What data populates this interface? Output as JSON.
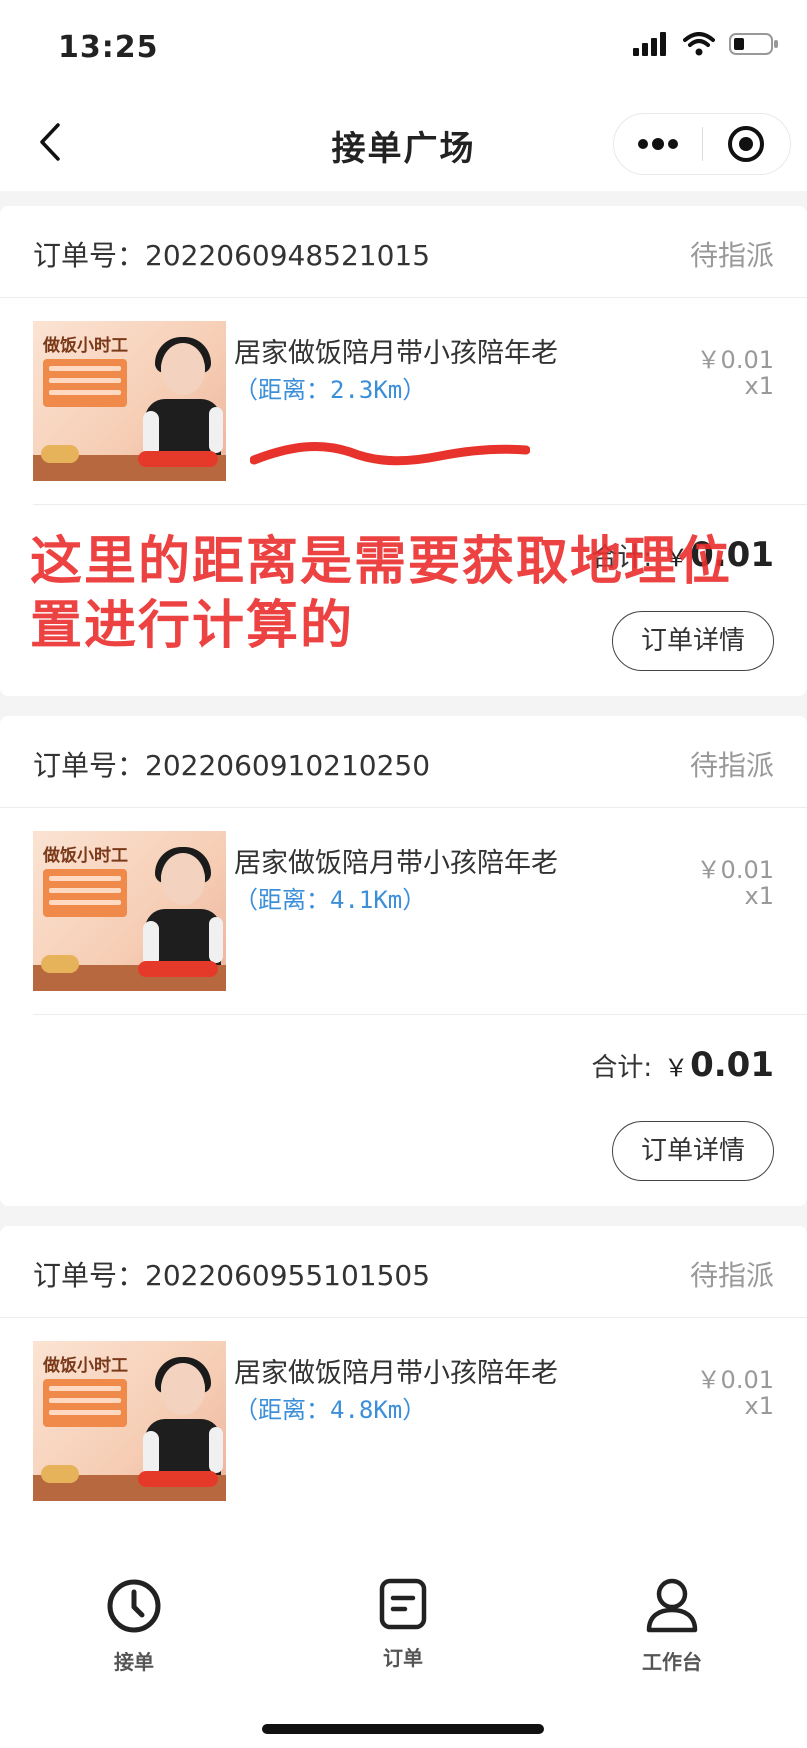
{
  "status_bar": {
    "time": "13:25"
  },
  "nav": {
    "title": "接单广场",
    "icons": {
      "back": "chevron-left-icon",
      "more": "more-dots-icon",
      "close": "target-circle-icon"
    }
  },
  "orders": [
    {
      "order_label": "订单号：",
      "order_no": "2022060948521015",
      "status": "待指派",
      "item_title": "居家做饭陪月带小孩陪年老",
      "distance": "（距离：2.3Km）",
      "price": "￥0.01",
      "qty": "x1",
      "thumb_title": "做饭小时工",
      "total_label": "合计:",
      "total_currency": "￥",
      "total_value": "0.01",
      "detail_button": "订单详情"
    },
    {
      "order_label": "订单号：",
      "order_no": "2022060910210250",
      "status": "待指派",
      "item_title": "居家做饭陪月带小孩陪年老",
      "distance": "（距离：4.1Km）",
      "price": "￥0.01",
      "qty": "x1",
      "thumb_title": "做饭小时工",
      "total_label": "合计:",
      "total_currency": "￥",
      "total_value": "0.01",
      "detail_button": "订单详情"
    },
    {
      "order_label": "订单号：",
      "order_no": "2022060955101505",
      "status": "待指派",
      "item_title": "居家做饭陪月带小孩陪年老",
      "distance": "（距离：4.8Km）",
      "price": "￥0.01",
      "qty": "x1",
      "thumb_title": "做饭小时工"
    }
  ],
  "annotation": {
    "text": "这里的距离是需要获取地理位置进行计算的",
    "color": "#eb2d2d"
  },
  "tabbar": {
    "items": [
      {
        "label": "接单",
        "icon": "clock-icon"
      },
      {
        "label": "订单",
        "icon": "document-icon"
      },
      {
        "label": "工作台",
        "icon": "user-icon"
      }
    ]
  },
  "colors": {
    "distance": "#3b8fd9",
    "muted": "#999999",
    "background": "#f4f4f4"
  }
}
